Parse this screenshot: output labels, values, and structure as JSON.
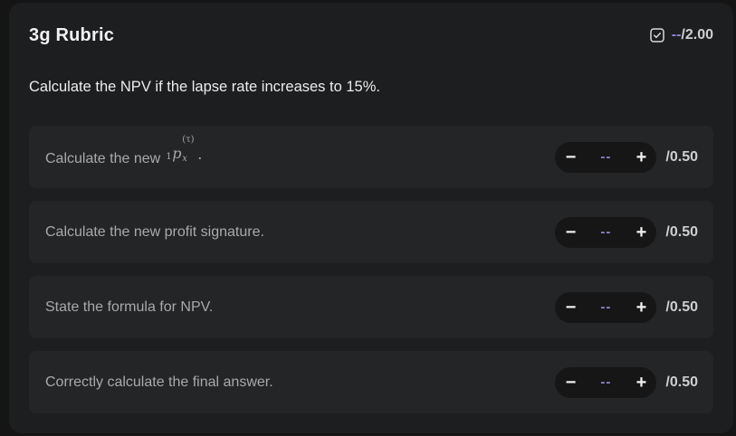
{
  "rubric": {
    "title": "3g Rubric",
    "score_dash": "--",
    "score_total": "/2.00",
    "status_icon": "checkbox-icon",
    "accent": "#8f86d6"
  },
  "question": "Calculate the NPV if the lapse rate increases to 15%.",
  "criteria": [
    {
      "label": "Calculate the new",
      "math": {
        "pre": "1",
        "base": "p",
        "sub": "x",
        "sup": "(τ)",
        "suffix": "."
      },
      "value": "--",
      "minus": "−",
      "plus": "+",
      "max": "/0.50"
    },
    {
      "label": "Calculate the new profit signature.",
      "value": "--",
      "minus": "−",
      "plus": "+",
      "max": "/0.50"
    },
    {
      "label": "State the formula for NPV.",
      "value": "--",
      "minus": "−",
      "plus": "+",
      "max": "/0.50"
    },
    {
      "label": "Correctly calculate the final answer.",
      "value": "--",
      "minus": "−",
      "plus": "+",
      "max": "/0.50"
    }
  ]
}
